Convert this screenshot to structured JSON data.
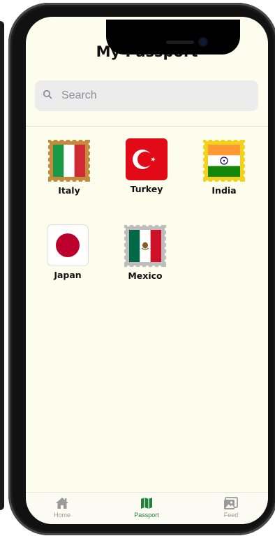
{
  "header": {
    "title": "My Passport"
  },
  "search": {
    "placeholder": "Search"
  },
  "countries": [
    {
      "name": "Italy",
      "flag": "italy-flag",
      "stamp_color": "#c58a3c"
    },
    {
      "name": "Turkey",
      "flag": "turkey-flag",
      "stamp_color": "#e30a17"
    },
    {
      "name": "India",
      "flag": "india-flag",
      "stamp_color": "#f3d21c"
    },
    {
      "name": "Japan",
      "flag": "japan-flag",
      "stamp_color": "#ffffff"
    },
    {
      "name": "Mexico",
      "flag": "mexico-flag",
      "stamp_color": "#bdbdbd"
    }
  ],
  "tabbar": {
    "tabs": [
      {
        "label": "Home",
        "icon": "home-icon",
        "active": false
      },
      {
        "label": "Passport",
        "icon": "map-icon",
        "active": true
      },
      {
        "label": "Feed",
        "icon": "photo-icon",
        "active": false
      }
    ]
  },
  "colors": {
    "background": "#fdfdee",
    "accent": "#21813a",
    "inactive": "#9a9a9a"
  }
}
